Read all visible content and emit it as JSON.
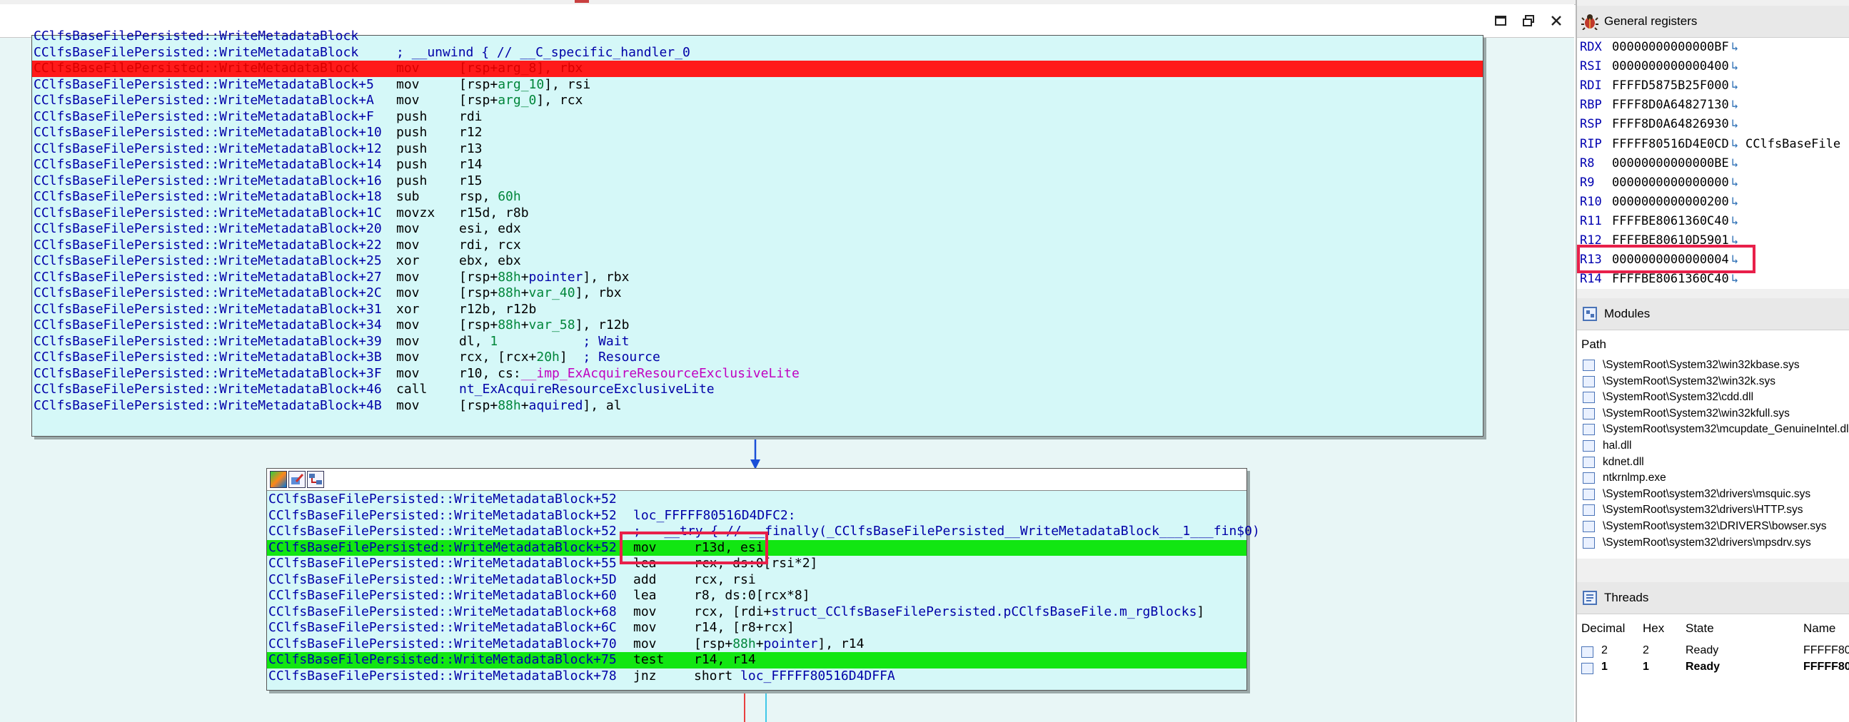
{
  "window": {
    "controls": [
      {
        "name": "restore-icon",
        "glyph": "□"
      },
      {
        "name": "float-icon",
        "glyph": "⧉"
      },
      {
        "name": "close-icon",
        "glyph": "✕"
      }
    ]
  },
  "block1": {
    "lines": [
      {
        "label": "CClfsBaseFilePersisted::WriteMetadataBlock",
        "mnem": "",
        "ops": []
      },
      {
        "label": "CClfsBaseFilePersisted::WriteMetadataBlock",
        "mnem": "",
        "ops": [
          {
            "t": "; __unwind { // __C_specific_handler_0",
            "c": "c-blue"
          }
        ]
      },
      {
        "label": "CClfsBaseFilePersisted::WriteMetadataBlock",
        "mnem": "mov",
        "ops": [
          {
            "t": "[rsp+",
            "c": ""
          },
          {
            "t": "arg_8",
            "c": "c-green"
          },
          {
            "t": "], rbx",
            "c": ""
          }
        ],
        "hl": "red"
      },
      {
        "label": "CClfsBaseFilePersisted::WriteMetadataBlock+5",
        "mnem": "mov",
        "ops": [
          {
            "t": "[rsp+",
            "c": ""
          },
          {
            "t": "arg_10",
            "c": "c-green"
          },
          {
            "t": "], rsi",
            "c": ""
          }
        ]
      },
      {
        "label": "CClfsBaseFilePersisted::WriteMetadataBlock+A",
        "mnem": "mov",
        "ops": [
          {
            "t": "[rsp+",
            "c": ""
          },
          {
            "t": "arg_0",
            "c": "c-green"
          },
          {
            "t": "], rcx",
            "c": ""
          }
        ]
      },
      {
        "label": "CClfsBaseFilePersisted::WriteMetadataBlock+F",
        "mnem": "push",
        "ops": [
          {
            "t": "rdi",
            "c": ""
          }
        ]
      },
      {
        "label": "CClfsBaseFilePersisted::WriteMetadataBlock+10",
        "mnem": "push",
        "ops": [
          {
            "t": "r12",
            "c": ""
          }
        ]
      },
      {
        "label": "CClfsBaseFilePersisted::WriteMetadataBlock+12",
        "mnem": "push",
        "ops": [
          {
            "t": "r13",
            "c": ""
          }
        ]
      },
      {
        "label": "CClfsBaseFilePersisted::WriteMetadataBlock+14",
        "mnem": "push",
        "ops": [
          {
            "t": "r14",
            "c": ""
          }
        ]
      },
      {
        "label": "CClfsBaseFilePersisted::WriteMetadataBlock+16",
        "mnem": "push",
        "ops": [
          {
            "t": "r15",
            "c": ""
          }
        ]
      },
      {
        "label": "CClfsBaseFilePersisted::WriteMetadataBlock+18",
        "mnem": "sub",
        "ops": [
          {
            "t": "rsp, ",
            "c": ""
          },
          {
            "t": "60h",
            "c": "c-green"
          }
        ]
      },
      {
        "label": "CClfsBaseFilePersisted::WriteMetadataBlock+1C",
        "mnem": "movzx",
        "ops": [
          {
            "t": "r15d, r8b",
            "c": ""
          }
        ]
      },
      {
        "label": "CClfsBaseFilePersisted::WriteMetadataBlock+20",
        "mnem": "mov",
        "ops": [
          {
            "t": "esi, edx",
            "c": ""
          }
        ]
      },
      {
        "label": "CClfsBaseFilePersisted::WriteMetadataBlock+22",
        "mnem": "mov",
        "ops": [
          {
            "t": "rdi, rcx",
            "c": ""
          }
        ]
      },
      {
        "label": "CClfsBaseFilePersisted::WriteMetadataBlock+25",
        "mnem": "xor",
        "ops": [
          {
            "t": "ebx, ebx",
            "c": ""
          }
        ]
      },
      {
        "label": "CClfsBaseFilePersisted::WriteMetadataBlock+27",
        "mnem": "mov",
        "ops": [
          {
            "t": "[rsp+",
            "c": ""
          },
          {
            "t": "88h",
            "c": "c-green"
          },
          {
            "t": "+",
            "c": ""
          },
          {
            "t": "pointer",
            "c": "c-blue"
          },
          {
            "t": "], rbx",
            "c": ""
          }
        ]
      },
      {
        "label": "CClfsBaseFilePersisted::WriteMetadataBlock+2C",
        "mnem": "mov",
        "ops": [
          {
            "t": "[rsp+",
            "c": ""
          },
          {
            "t": "88h",
            "c": "c-green"
          },
          {
            "t": "+",
            "c": ""
          },
          {
            "t": "var_40",
            "c": "c-green"
          },
          {
            "t": "], rbx",
            "c": ""
          }
        ]
      },
      {
        "label": "CClfsBaseFilePersisted::WriteMetadataBlock+31",
        "mnem": "xor",
        "ops": [
          {
            "t": "r12b, r12b",
            "c": ""
          }
        ]
      },
      {
        "label": "CClfsBaseFilePersisted::WriteMetadataBlock+34",
        "mnem": "mov",
        "ops": [
          {
            "t": "[rsp+",
            "c": ""
          },
          {
            "t": "88h",
            "c": "c-green"
          },
          {
            "t": "+",
            "c": ""
          },
          {
            "t": "var_58",
            "c": "c-green"
          },
          {
            "t": "], r12b",
            "c": ""
          }
        ]
      },
      {
        "label": "CClfsBaseFilePersisted::WriteMetadataBlock+39",
        "mnem": "mov",
        "ops": [
          {
            "t": "dl, ",
            "c": ""
          },
          {
            "t": "1",
            "c": "c-green"
          },
          {
            "t": "           ",
            "c": ""
          },
          {
            "t": "; Wait",
            "c": "c-blue"
          }
        ]
      },
      {
        "label": "CClfsBaseFilePersisted::WriteMetadataBlock+3B",
        "mnem": "mov",
        "ops": [
          {
            "t": "rcx, [rcx+",
            "c": ""
          },
          {
            "t": "20h",
            "c": "c-green"
          },
          {
            "t": "]  ",
            "c": ""
          },
          {
            "t": "; Resource",
            "c": "c-blue"
          }
        ]
      },
      {
        "label": "CClfsBaseFilePersisted::WriteMetadataBlock+3F",
        "mnem": "mov",
        "ops": [
          {
            "t": "r10, cs:",
            "c": ""
          },
          {
            "t": "__imp_ExAcquireResourceExclusiveLite",
            "c": "c-magenta"
          }
        ]
      },
      {
        "label": "CClfsBaseFilePersisted::WriteMetadataBlock+46",
        "mnem": "call",
        "ops": [
          {
            "t": "nt_ExAcquireResourceExclusiveLite",
            "c": "c-blue"
          }
        ]
      },
      {
        "label": "CClfsBaseFilePersisted::WriteMetadataBlock+4B",
        "mnem": "mov",
        "ops": [
          {
            "t": "[rsp+",
            "c": ""
          },
          {
            "t": "88h",
            "c": "c-green"
          },
          {
            "t": "+",
            "c": ""
          },
          {
            "t": "aquired",
            "c": "c-blue"
          },
          {
            "t": "], al",
            "c": ""
          }
        ]
      }
    ]
  },
  "block2": {
    "lines": [
      {
        "label": "CClfsBaseFilePersisted::WriteMetadataBlock+52",
        "mnem": "",
        "ops": []
      },
      {
        "label": "CClfsBaseFilePersisted::WriteMetadataBlock+52",
        "mnem": "",
        "ops": [
          {
            "t": "loc_FFFFF80516D4DFC2:",
            "c": "c-blue"
          }
        ]
      },
      {
        "label": "CClfsBaseFilePersisted::WriteMetadataBlock+52",
        "mnem": "",
        "ops": [
          {
            "t": ";   __try { // __finally(_CClfsBaseFilePersisted__WriteMetadataBlock___1___fin$0)",
            "c": "c-blue"
          }
        ]
      },
      {
        "label": "CClfsBaseFilePersisted::WriteMetadataBlock+52",
        "mnem": "mov",
        "ops": [
          {
            "t": "r13d, esi",
            "c": ""
          }
        ],
        "hl": "green"
      },
      {
        "label": "CClfsBaseFilePersisted::WriteMetadataBlock+55",
        "mnem": "lea",
        "ops": [
          {
            "t": "rcx, ds:0[rsi*2]",
            "c": ""
          }
        ]
      },
      {
        "label": "CClfsBaseFilePersisted::WriteMetadataBlock+5D",
        "mnem": "add",
        "ops": [
          {
            "t": "rcx, rsi",
            "c": ""
          }
        ]
      },
      {
        "label": "CClfsBaseFilePersisted::WriteMetadataBlock+60",
        "mnem": "lea",
        "ops": [
          {
            "t": "r8, ds:0[rcx*8]",
            "c": ""
          }
        ]
      },
      {
        "label": "CClfsBaseFilePersisted::WriteMetadataBlock+68",
        "mnem": "mov",
        "ops": [
          {
            "t": "rcx, [rdi+",
            "c": ""
          },
          {
            "t": "struct_CClfsBaseFilePersisted.pCClfsBaseFile.m_rgBlocks",
            "c": "c-blue"
          },
          {
            "t": "]",
            "c": ""
          }
        ]
      },
      {
        "label": "CClfsBaseFilePersisted::WriteMetadataBlock+6C",
        "mnem": "mov",
        "ops": [
          {
            "t": "r14, [r8+rcx]",
            "c": ""
          }
        ]
      },
      {
        "label": "CClfsBaseFilePersisted::WriteMetadataBlock+70",
        "mnem": "mov",
        "ops": [
          {
            "t": "[rsp+",
            "c": ""
          },
          {
            "t": "88h",
            "c": "c-green"
          },
          {
            "t": "+",
            "c": ""
          },
          {
            "t": "pointer",
            "c": "c-blue"
          },
          {
            "t": "], r14",
            "c": ""
          }
        ]
      },
      {
        "label": "CClfsBaseFilePersisted::WriteMetadataBlock+75",
        "mnem": "test",
        "ops": [
          {
            "t": "r14, r14",
            "c": ""
          }
        ],
        "hl": "green"
      },
      {
        "label": "CClfsBaseFilePersisted::WriteMetadataBlock+78",
        "mnem": "jnz",
        "ops": [
          {
            "t": "short ",
            "c": ""
          },
          {
            "t": "loc_FFFFF80516D4DFFA",
            "c": "c-blue"
          }
        ]
      }
    ]
  },
  "registers": {
    "title": "General registers",
    "rows": [
      {
        "name": "RDX",
        "value": "00000000000000BF",
        "extra": ""
      },
      {
        "name": "RSI",
        "value": "0000000000000400",
        "extra": ""
      },
      {
        "name": "RDI",
        "value": "FFFFD5875B25F000",
        "extra": ""
      },
      {
        "name": "RBP",
        "value": "FFFF8D0A64827130",
        "extra": ""
      },
      {
        "name": "RSP",
        "value": "FFFF8D0A64826930",
        "extra": ""
      },
      {
        "name": "RIP",
        "value": "FFFFF80516D4E0CD",
        "extra": "CClfsBaseFile"
      },
      {
        "name": "R8",
        "value": "00000000000000BE",
        "extra": ""
      },
      {
        "name": "R9",
        "value": "0000000000000000",
        "extra": ""
      },
      {
        "name": "R10",
        "value": "0000000000000200",
        "extra": ""
      },
      {
        "name": "R11",
        "value": "FFFFBE8061360C40",
        "extra": ""
      },
      {
        "name": "R12",
        "value": "FFFFBE80610D5901",
        "extra": ""
      },
      {
        "name": "R13",
        "value": "0000000000000004",
        "extra": ""
      },
      {
        "name": "R14",
        "value": "FFFFBE8061360C40",
        "extra": ""
      }
    ],
    "arrow": "↳"
  },
  "modules": {
    "title": "Modules",
    "column": "Path",
    "rows": [
      "\\SystemRoot\\System32\\win32kbase.sys",
      "\\SystemRoot\\System32\\win32k.sys",
      "\\SystemRoot\\System32\\cdd.dll",
      "\\SystemRoot\\System32\\win32kfull.sys",
      "\\SystemRoot\\system32\\mcupdate_GenuineIntel.dll",
      "hal.dll",
      "kdnet.dll",
      "ntkrnlmp.exe",
      "\\SystemRoot\\system32\\drivers\\msquic.sys",
      "\\SystemRoot\\system32\\drivers\\HTTP.sys",
      "\\SystemRoot\\system32\\DRIVERS\\bowser.sys",
      "\\SystemRoot\\system32\\drivers\\mpsdrv.sys"
    ]
  },
  "threads": {
    "title": "Threads",
    "columns": [
      "Decimal",
      "Hex",
      "State",
      "Name"
    ],
    "rows": [
      {
        "decimal": "2",
        "hex": "2",
        "state": "Ready",
        "name": "FFFFF80"
      },
      {
        "decimal": "1",
        "hex": "1",
        "state": "Ready",
        "name": "FFFFF80"
      }
    ]
  }
}
